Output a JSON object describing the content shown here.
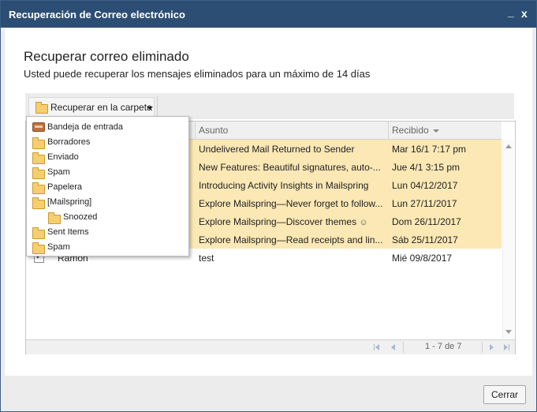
{
  "window": {
    "title": "Recuperación de Correo electrónico",
    "minimize_label": "_",
    "close_label": "x"
  },
  "main": {
    "heading": "Recuperar correo eliminado",
    "subheading": "Usted puede recuperar los mensajes eliminados para un máximo de 14 días"
  },
  "toolbar": {
    "recover_label": "Recuperar en la carpeta"
  },
  "dropdown": {
    "items": [
      {
        "label": "Bandeja de entrada",
        "icon": "inbox-icon"
      },
      {
        "label": "Borradores",
        "icon": "folder-icon"
      },
      {
        "label": "Enviado",
        "icon": "folder-icon"
      },
      {
        "label": "Spam",
        "icon": "folder-icon"
      },
      {
        "label": "Papelera",
        "icon": "folder-icon"
      },
      {
        "label": "[Mailspring]",
        "icon": "folder-icon"
      },
      {
        "label": "Snoozed",
        "icon": "folder-icon"
      },
      {
        "label": "Sent Items",
        "icon": "folder-icon"
      },
      {
        "label": "Spam",
        "icon": "folder-icon"
      }
    ]
  },
  "grid": {
    "columns": {
      "subject": "Asunto",
      "received": "Recibido"
    },
    "rows": [
      {
        "from": "",
        "subject": "Undelivered Mail Returned to Sender",
        "received": "Mar 16/1 7:17 pm",
        "checked": false
      },
      {
        "from": "",
        "subject": "New Features: Beautiful signatures, auto-...",
        "received": "Jue 4/1 3:15 pm",
        "checked": false
      },
      {
        "from": "",
        "subject": "Introducing Activity Insights in Mailspring",
        "received": "Lun 04/12/2017",
        "checked": false
      },
      {
        "from": "",
        "subject": "Explore Mailspring—Never forget to follow...",
        "received": "Lun 27/11/2017",
        "checked": false
      },
      {
        "from": "",
        "subject": "Explore Mailspring—Discover themes",
        "received": "Dom 26/11/2017",
        "checked": false
      },
      {
        "from": "",
        "subject": "Explore Mailspring—Read receipts and lin...",
        "received": "Sáb 25/11/2017",
        "checked": false
      },
      {
        "from": "Ramon",
        "subject": "test",
        "received": "Mié 09/8/2017",
        "checked": true
      }
    ],
    "pager_text": "1 - 7 de 7"
  },
  "footer": {
    "close_label": "Cerrar"
  },
  "colors": {
    "titlebar": "#2c4e74",
    "row_highlight": "#fbe8b5"
  }
}
